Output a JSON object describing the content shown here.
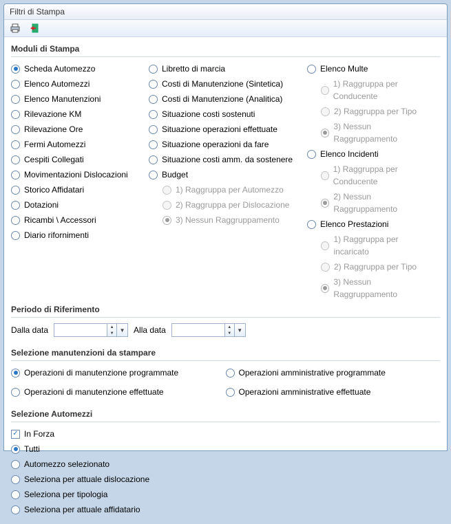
{
  "window": {
    "title": "Filtri di Stampa"
  },
  "toolbar": {
    "print": "print-icon",
    "exit": "exit-icon"
  },
  "headers": {
    "modules": "Moduli di Stampa",
    "period": "Periodo di Riferimento",
    "maint": "Selezione manutenzioni da stampare",
    "vehicles": "Selezione Automezzi"
  },
  "labels": {
    "from_date": "Dalla data",
    "to_date": "Alla data"
  },
  "modules": {
    "colA": [
      {
        "label": "Scheda Automezzo",
        "sel": true
      },
      {
        "label": "Elenco Automezzi"
      },
      {
        "label": "Elenco Manutenzioni"
      },
      {
        "label": "Rilevazione KM"
      },
      {
        "label": "Rilevazione Ore"
      },
      {
        "label": "Fermi Automezzi"
      },
      {
        "label": "Cespiti Collegati"
      },
      {
        "label": "Movimentazioni Dislocazioni"
      },
      {
        "label": "Storico Affidatari"
      },
      {
        "label": "Dotazioni"
      },
      {
        "label": "Ricambi \\ Accessori"
      },
      {
        "label": "Diario rifornimenti"
      }
    ],
    "colB": [
      {
        "label": "Libretto di marcia"
      },
      {
        "label": "Costi di Manutenzione (Sintetica)"
      },
      {
        "label": "Costi di Manutenzione (Analitica)"
      },
      {
        "label": "Situazione costi sostenuti"
      },
      {
        "label": "Situazione operazioni effettuate"
      },
      {
        "label": "Situazione operazioni da fare"
      },
      {
        "label": "Situazione costi amm. da sostenere"
      },
      {
        "label": "Budget"
      }
    ],
    "budget_sub": [
      {
        "label": "1) Raggruppa per Automezzo",
        "dis": true
      },
      {
        "label": "2) Raggruppa per Dislocazione",
        "dis": true
      },
      {
        "label": "3) Nessun Raggruppamento",
        "dis": true,
        "sel_grey": true
      }
    ],
    "colC": [
      {
        "label": "Elenco Multe"
      }
    ],
    "multe_sub": [
      {
        "label": "1) Raggruppa per Conducente",
        "dis": true
      },
      {
        "label": "2) Raggruppa per Tipo",
        "dis": true
      },
      {
        "label": "3) Nessun Raggruppamento",
        "dis": true,
        "sel_grey": true
      }
    ],
    "incidenti_head": {
      "label": "Elenco Incidenti"
    },
    "incidenti_sub": [
      {
        "label": "1) Raggruppa per Conducente",
        "dis": true
      },
      {
        "label": "2) Nessun Raggruppamento",
        "dis": true,
        "sel_grey": true
      }
    ],
    "prestazioni_head": {
      "label": "Elenco Prestazioni"
    },
    "prestazioni_sub": [
      {
        "label": "1) Raggruppa per incaricato",
        "dis": true
      },
      {
        "label": "2) Raggruppa per Tipo",
        "dis": true
      },
      {
        "label": "3) Nessun Raggruppamento",
        "dis": true,
        "sel_grey": true
      }
    ]
  },
  "maint_options": [
    {
      "label": "Operazioni di manutenzione programmate",
      "sel": true
    },
    {
      "label": "Operazioni amministrative programmate"
    },
    {
      "label": "Operazioni di manutenzione effettuate"
    },
    {
      "label": "Operazioni amministrative effettuate"
    }
  ],
  "vehicles": {
    "in_forza": {
      "label": "In Forza",
      "checked": true
    },
    "opts": [
      {
        "label": "Tutti",
        "sel": true
      },
      {
        "label": "Automezzo selezionato"
      },
      {
        "label": "Seleziona per attuale dislocazione"
      },
      {
        "label": "Seleziona per tipologia"
      },
      {
        "label": "Seleziona per attuale affidatario"
      }
    ]
  }
}
